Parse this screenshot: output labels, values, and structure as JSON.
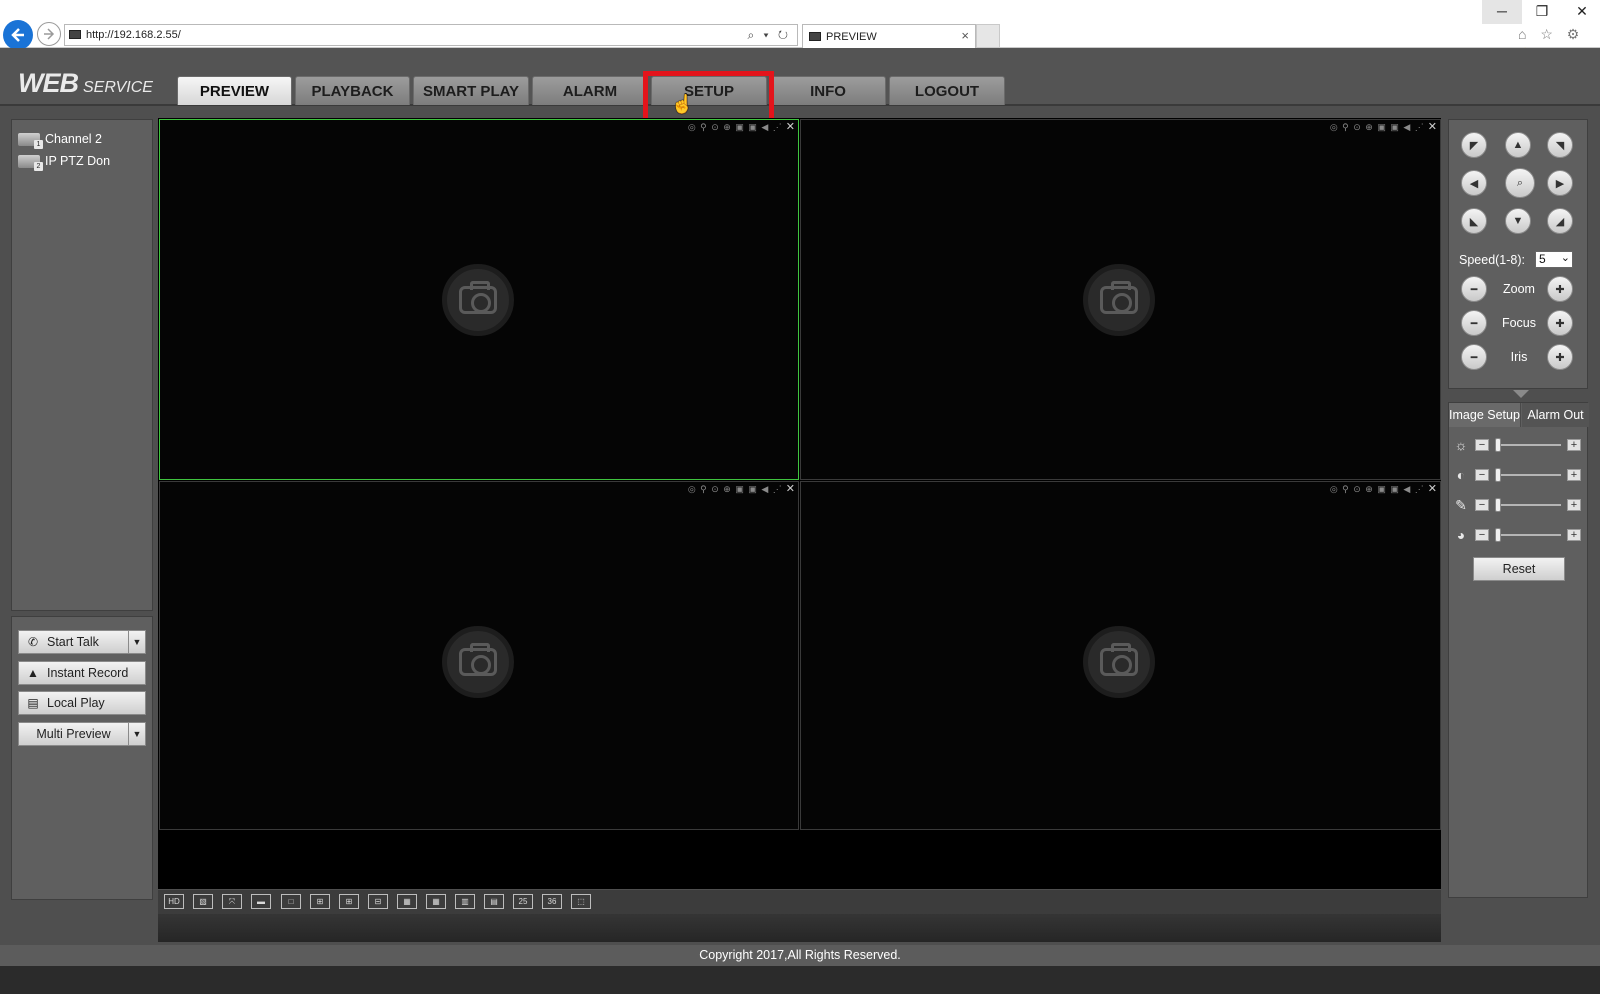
{
  "browser": {
    "url": "http://192.168.2.55/",
    "tab_title": "PREVIEW",
    "tab_close": "×",
    "address_tools": "⌕ ▾ ↻",
    "win_min": "─",
    "win_restore": "❐",
    "win_close": "✕",
    "icons": "⌂ ☆ ⚙"
  },
  "logo": {
    "web": "WEB",
    "service": "SERVICE"
  },
  "nav_tabs": [
    "PREVIEW",
    "PLAYBACK",
    "SMART PLAY",
    "ALARM",
    "SETUP",
    "INFO",
    "LOGOUT"
  ],
  "active_tab": "PREVIEW",
  "highlighted_tab": "SETUP",
  "channels": [
    {
      "label": "Channel 2",
      "badge": "1"
    },
    {
      "label": "IP PTZ Don",
      "badge": "2"
    }
  ],
  "actions": {
    "start_talk": "Start Talk",
    "instant_record": "Instant Record",
    "local_play": "Local Play",
    "multi_preview": "Multi Preview"
  },
  "video_cells": 4,
  "cell_toolbar_icons": "◎ ⚲ ⊙ ⊕ ▣ ▣ ◀ ⋰",
  "cell_close": "✕",
  "layout_buttons": [
    "HD",
    "▧",
    "⤧",
    "▬",
    "□",
    "⊞",
    "⊞",
    "⊟",
    "▦",
    "▦",
    "▥",
    "▤",
    "25",
    "36",
    "⬚"
  ],
  "ptz": {
    "speed_label": "Speed(1-8):",
    "speed_value": "5",
    "zoom_label": "Zoom",
    "focus_label": "Focus",
    "iris_label": "Iris"
  },
  "image_panel": {
    "tab_image_setup": "Image Setup",
    "tab_alarm_out": "Alarm Out",
    "reset_label": "Reset",
    "sliders": [
      {
        "name": "brightness",
        "icon": "☼",
        "value": 0
      },
      {
        "name": "contrast",
        "icon": "◐",
        "value": 0
      },
      {
        "name": "saturation",
        "icon": "✎",
        "value": 0
      },
      {
        "name": "hue",
        "icon": "◕",
        "value": 0
      }
    ]
  },
  "footer": {
    "copyright": "Copyright 2017,All Rights Reserved."
  }
}
